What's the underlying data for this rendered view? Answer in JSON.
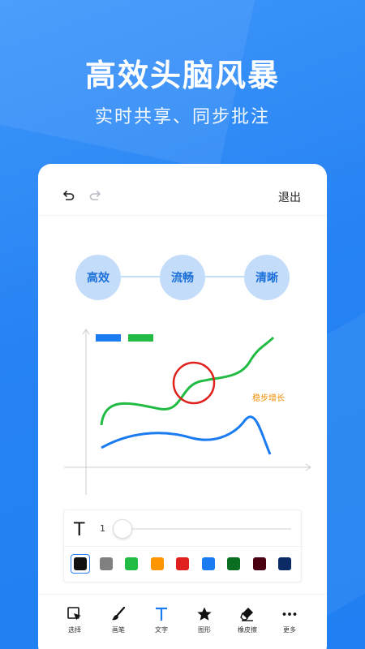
{
  "header": {
    "title": "高效头脑风暴",
    "subtitle": "实时共享、同步批注"
  },
  "topbar": {
    "exit_label": "退出"
  },
  "mindmap": {
    "nodes": [
      "高效",
      "流畅",
      "清晰"
    ]
  },
  "drawing": {
    "annotation": "稳步增长",
    "legend_colors": [
      "#1a7cf0",
      "#22bb44"
    ]
  },
  "text_panel": {
    "size_value": "1",
    "slider_level": 0.0,
    "colors": [
      "#111111",
      "#808080",
      "#22bb44",
      "#ff9500",
      "#e0201c",
      "#1a7cf0",
      "#0a6e20",
      "#4a0010",
      "#0b2a66"
    ],
    "selected_color_index": 0
  },
  "toolbar": {
    "items": [
      {
        "label": "选择",
        "icon": "select-cursor-icon"
      },
      {
        "label": "画笔",
        "icon": "brush-icon"
      },
      {
        "label": "文字",
        "icon": "text-icon"
      },
      {
        "label": "图形",
        "icon": "star-shape-icon"
      },
      {
        "label": "橡皮擦",
        "icon": "eraser-icon"
      },
      {
        "label": "更多",
        "icon": "more-dots-icon"
      }
    ],
    "active_index": 2,
    "accent": "#1a7cf0"
  }
}
